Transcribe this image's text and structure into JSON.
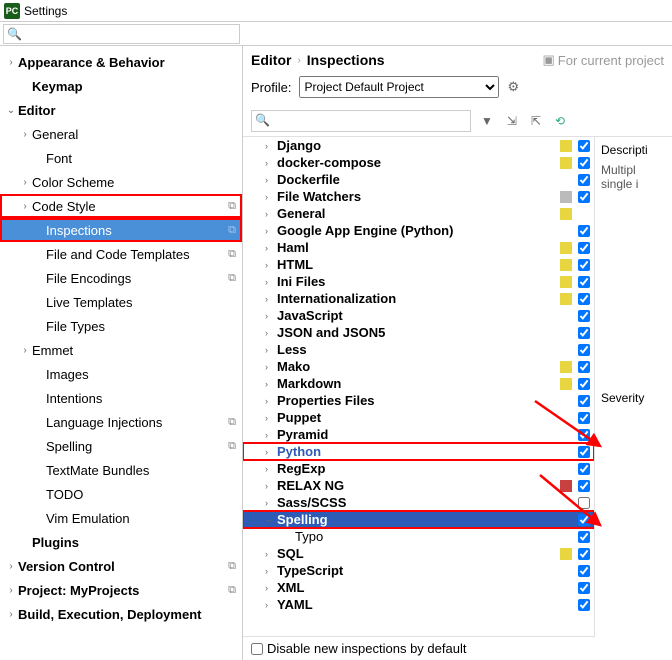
{
  "window": {
    "title": "Settings",
    "logo": "PC"
  },
  "sidebar": {
    "search_placeholder": "",
    "items": [
      {
        "label": "Appearance & Behavior",
        "level": 0,
        "bold": true,
        "chev": "›"
      },
      {
        "label": "Keymap",
        "level": 1,
        "bold": true
      },
      {
        "label": "Editor",
        "level": 0,
        "bold": true,
        "chev": "⌄"
      },
      {
        "label": "General",
        "level": 1,
        "chev": "›"
      },
      {
        "label": "Font",
        "level": 2
      },
      {
        "label": "Color Scheme",
        "level": 1,
        "chev": "›"
      },
      {
        "label": "Code Style",
        "level": 1,
        "chev": "›",
        "dup": true,
        "highlighted": true
      },
      {
        "label": "Inspections",
        "level": 2,
        "dup": true,
        "selected": true,
        "highlighted": true
      },
      {
        "label": "File and Code Templates",
        "level": 2,
        "dup": true
      },
      {
        "label": "File Encodings",
        "level": 2,
        "dup": true
      },
      {
        "label": "Live Templates",
        "level": 2
      },
      {
        "label": "File Types",
        "level": 2
      },
      {
        "label": "Emmet",
        "level": 1,
        "chev": "›"
      },
      {
        "label": "Images",
        "level": 2
      },
      {
        "label": "Intentions",
        "level": 2
      },
      {
        "label": "Language Injections",
        "level": 2,
        "dup": true
      },
      {
        "label": "Spelling",
        "level": 2,
        "dup": true
      },
      {
        "label": "TextMate Bundles",
        "level": 2
      },
      {
        "label": "TODO",
        "level": 2
      },
      {
        "label": "Vim Emulation",
        "level": 2
      },
      {
        "label": "Plugins",
        "level": 1,
        "bold": true
      },
      {
        "label": "Version Control",
        "level": 0,
        "bold": true,
        "chev": "›",
        "dup": true
      },
      {
        "label": "Project: MyProjects",
        "level": 0,
        "bold": true,
        "chev": "›",
        "dup": true
      },
      {
        "label": "Build, Execution, Deployment",
        "level": 0,
        "bold": true,
        "chev": "›"
      }
    ]
  },
  "breadcrumb": {
    "a": "Editor",
    "b": "Inspections",
    "proj": "For current project"
  },
  "profile": {
    "label": "Profile:",
    "selected": "Project Default Project"
  },
  "inspections": {
    "search_placeholder": "",
    "items": [
      {
        "name": "Django",
        "chev": "›",
        "sq": "yellow",
        "checked": true
      },
      {
        "name": "docker-compose",
        "chev": "›",
        "sq": "yellow",
        "checked": true
      },
      {
        "name": "Dockerfile",
        "chev": "›",
        "checked": true
      },
      {
        "name": "File Watchers",
        "chev": "›",
        "sq": "gray",
        "checked": true
      },
      {
        "name": "General",
        "chev": "›",
        "sq": "yellow",
        "nocb": true
      },
      {
        "name": "Google App Engine (Python)",
        "chev": "›",
        "checked": true
      },
      {
        "name": "Haml",
        "chev": "›",
        "sq": "yellow",
        "checked": true
      },
      {
        "name": "HTML",
        "chev": "›",
        "sq": "yellow",
        "checked": true
      },
      {
        "name": "Ini Files",
        "chev": "›",
        "sq": "yellow",
        "checked": true
      },
      {
        "name": "Internationalization",
        "chev": "›",
        "sq": "yellow",
        "checked": true
      },
      {
        "name": "JavaScript",
        "chev": "›",
        "checked": true
      },
      {
        "name": "JSON and JSON5",
        "chev": "›",
        "checked": true
      },
      {
        "name": "Less",
        "chev": "›",
        "checked": true
      },
      {
        "name": "Mako",
        "chev": "›",
        "sq": "yellow",
        "checked": true
      },
      {
        "name": "Markdown",
        "chev": "›",
        "sq": "yellow",
        "checked": true
      },
      {
        "name": "Properties Files",
        "chev": "›",
        "checked": true
      },
      {
        "name": "Puppet",
        "chev": "›",
        "checked": true
      },
      {
        "name": "Pyramid",
        "chev": "›",
        "checked": true
      },
      {
        "name": "Python",
        "chev": "›",
        "sel": 1,
        "hl": true,
        "checked": true
      },
      {
        "name": "RegExp",
        "chev": "›",
        "checked": true
      },
      {
        "name": "RELAX NG",
        "chev": "›",
        "sq": "red",
        "checked": true
      },
      {
        "name": "Sass/SCSS",
        "chev": "›",
        "checked": false
      },
      {
        "name": "Spelling",
        "chev": "⌄",
        "sel": 2,
        "hl": true,
        "checked": true
      },
      {
        "name": "Typo",
        "level": 2,
        "nonbold": true,
        "checked": true
      },
      {
        "name": "SQL",
        "chev": "›",
        "sq": "yellow",
        "checked": true
      },
      {
        "name": "TypeScript",
        "chev": "›",
        "checked": true
      },
      {
        "name": "XML",
        "chev": "›",
        "checked": true
      },
      {
        "name": "YAML",
        "chev": "›",
        "checked": true
      }
    ],
    "disable_label": "Disable new inspections by default"
  },
  "desc": {
    "heading": "Descripti",
    "text": "Multipl",
    "text2": "single i",
    "sev": "Severity"
  }
}
